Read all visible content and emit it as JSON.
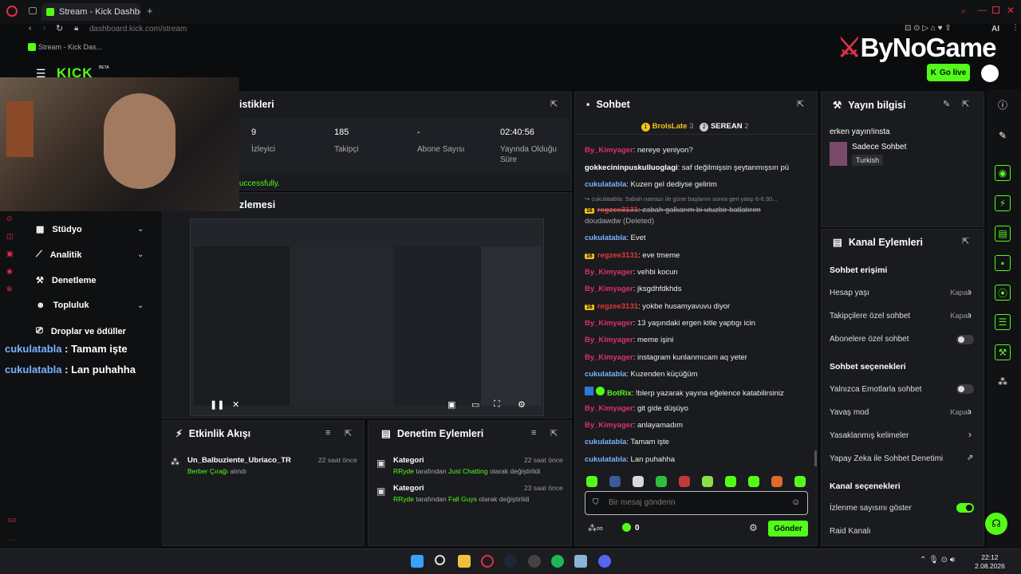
{
  "browser": {
    "tab_title": "Stream - Kick Dashboard",
    "new_tab": "+",
    "url_domain": "dashboard.kick.com",
    "url_path": "/stream",
    "bookmark": "Stream - Kick Das...",
    "ai_label": "AI"
  },
  "header": {
    "logo": "KICK",
    "logo_beta": "BETA",
    "watermark": "ByNoGame",
    "go_live": "Go live"
  },
  "stats": {
    "title": "istikleri",
    "items": [
      {
        "value": "9",
        "label": "İzleyici"
      },
      {
        "value": "185",
        "label": "Takipçi"
      },
      {
        "value": "-",
        "label": "Abone Sayısı"
      },
      {
        "value": "02:40:56",
        "label": "Yayında Olduğu Süre"
      }
    ],
    "success_msg": "uccessfully."
  },
  "preview": {
    "title": "zlemesi"
  },
  "sidebar": {
    "items": [
      {
        "label": "Stüdyo"
      },
      {
        "label": "Analitik"
      },
      {
        "label": "Denetleme"
      },
      {
        "label": "Topluluk"
      },
      {
        "label": "Droplar ve ödüller"
      }
    ]
  },
  "overlay_chat": [
    {
      "user": "cukulatabla",
      "text": " : Tamam işte"
    },
    {
      "user": "cukulatabla",
      "text": " : Lan puhahha"
    }
  ],
  "activity": {
    "title": "Etkinlik Akışı",
    "items": [
      {
        "user": "Un_Balbuziente_Ubriaco_TR",
        "time": "22 saat önce",
        "reward": "Berber Çırağı",
        "suffix": " alındı"
      }
    ]
  },
  "moderation": {
    "title": "Denetim Eylemleri",
    "items": [
      {
        "title": "Kategori",
        "time": "22 saat önce",
        "by": "RRyde",
        "mid": " tarafından ",
        "value": "Just Chatting",
        "tail": " olarak değiştirildi"
      },
      {
        "title": "Kategori",
        "time": "23 saat önce",
        "by": "RRyde",
        "mid": " tarafından ",
        "value": "Fall Guys",
        "tail": " olarak değiştirildi"
      }
    ]
  },
  "chat": {
    "title": "Sohbet",
    "top_gifters": [
      {
        "rank": "1",
        "name": "BrolsLate",
        "count": "3"
      },
      {
        "rank": "2",
        "name": "SEREAN",
        "count": "2"
      }
    ],
    "messages": [
      {
        "user": "By_Kimyager",
        "text": ": nereye yeniyon?",
        "style": "red"
      },
      {
        "user": "gokkecininpuskulluoglagi",
        "text": ": saf değilmişsin şeytanmışsın pü",
        "style": "white"
      },
      {
        "user": "cukulatabla",
        "text": ": Kuzen gel dediyse gelirim",
        "style": "blue"
      },
      {
        "user": "",
        "text": "↪ cukulatabla: Sabah namazı ile güne başlarım sonra geri yatıp 6-6.30...",
        "style": "reply"
      },
      {
        "user": "regzee3131",
        "text": ": zabah galkarım bi utuzbir batlatırım",
        "style": "deleted",
        "badge": "16"
      },
      {
        "user": "",
        "text": "doudawdw (Deleted)",
        "style": "deleted2"
      },
      {
        "user": "cukulatabla",
        "text": ": Evet",
        "style": "blue"
      },
      {
        "user": "regzee3131",
        "text": ": eve tmeme",
        "style": "red2",
        "badge": "16"
      },
      {
        "user": "By_Kimyager",
        "text": ": vehbi kocun",
        "style": "red"
      },
      {
        "user": "By_Kimyager",
        "text": ": jksgdhfdkhds",
        "style": "red"
      },
      {
        "user": "regzee3131",
        "text": ": yokbe husamyavuvu diyor",
        "style": "red2",
        "badge": "16"
      },
      {
        "user": "By_Kimyager",
        "text": ": 13 yaşındaki ergen kitle yaptıgı icin",
        "style": "red"
      },
      {
        "user": "By_Kimyager",
        "text": ": meme işini",
        "style": "red"
      },
      {
        "user": "By_Kimyager",
        "text": ": instagram kunlanmıcam aq yeter",
        "style": "red"
      },
      {
        "user": "cukulatabla",
        "text": ": Kuzenden küçüğüm",
        "style": "blue"
      },
      {
        "user": "BotRix",
        "text": ": !blerp yazarak yayına eğelence katabilirsiniz",
        "style": "green"
      },
      {
        "user": "By_Kimyager",
        "text": ": git gide düşüyo",
        "style": "red"
      },
      {
        "user": "By_Kimyager",
        "text": ": anlayamadım",
        "style": "red"
      },
      {
        "user": "cukulatabla",
        "text": ": Tamam işte",
        "style": "blue"
      },
      {
        "user": "cukulatabla",
        "text": ": Lan puhahha",
        "style": "blue"
      }
    ],
    "input_placeholder": "Bir mesaj gönderin",
    "points": "0",
    "send": "Gönder"
  },
  "stream_info": {
    "title": "Yayın bilgisi",
    "stream_title": "erken yayın!insta",
    "category": "Sadece Sohbet",
    "language": "Turkish"
  },
  "channel_actions": {
    "title": "Kanal Eylemleri",
    "chat_access": "Sohbet erişimi",
    "account_age": "Hesap yaşı",
    "account_age_val": "Kapalı",
    "followers_only": "Takipçilere özel sohbet",
    "followers_only_val": "Kapalı",
    "subs_only": "Abonelere özel sohbet",
    "chat_options": "Sohbet seçenekleri",
    "emote_only": "Yalnızca Emotlarla sohbet",
    "slow_mode": "Yavaş mod",
    "slow_mode_val": "Kapalı",
    "banned_words": "Yasaklanmış kelimeler",
    "ai_moderation": "Yapay Zeka ile Sohbet Denetimi",
    "channel_options": "Kanal seçenekleri",
    "show_viewers": "İzlenme sayısını göster",
    "raid": "Raid Kanalı"
  },
  "taskbar": {
    "time": "22:12",
    "date": "2.08.2026"
  },
  "colors": {
    "accent": "#53fc18",
    "panel": "#191b1f",
    "bg": "#0b0c0d"
  }
}
